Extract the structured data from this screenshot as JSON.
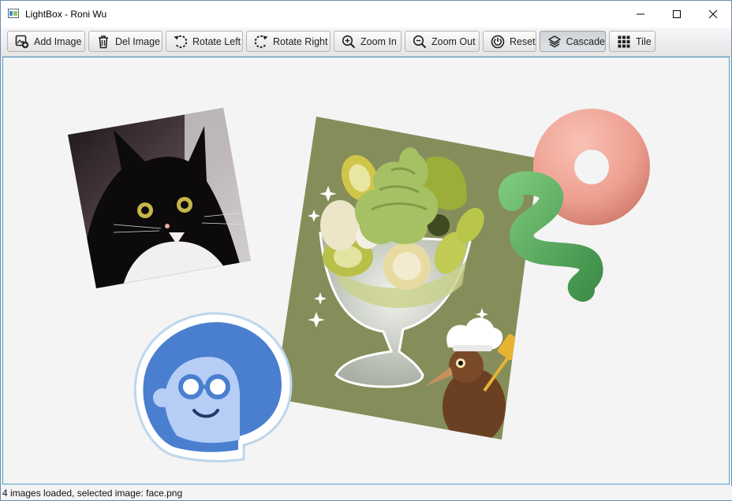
{
  "window": {
    "title": "LightBox - Roni Wu"
  },
  "toolbar": {
    "buttons": [
      {
        "label": "Add Image",
        "icon": "add-image-icon"
      },
      {
        "label": "Del Image",
        "icon": "trash-icon"
      },
      {
        "label": "Rotate Left",
        "icon": "rotate-left-icon"
      },
      {
        "label": "Rotate Right",
        "icon": "rotate-right-icon"
      },
      {
        "label": "Zoom In",
        "icon": "zoom-in-icon"
      },
      {
        "label": "Zoom Out",
        "icon": "zoom-out-icon"
      },
      {
        "label": "Reset",
        "icon": "power-icon"
      },
      {
        "label": "Cascade",
        "icon": "layers-icon",
        "pressed": true
      },
      {
        "label": "Tile",
        "icon": "grid-icon"
      }
    ]
  },
  "canvas": {
    "images": [
      {
        "name": "cat",
        "content": "black-and-white cat photo"
      },
      {
        "name": "parfait",
        "content": "kiwi parfait with chef kiwi bird illustration"
      },
      {
        "name": "donut-squiggle",
        "content": "pink 3D donut and green squiggle"
      },
      {
        "name": "face",
        "content": "blue face sticker",
        "selected": true
      }
    ]
  },
  "status": {
    "text": "4 images loaded, selected image: face.png"
  },
  "colors": {
    "canvas_border": "#4aa3d1",
    "window_border": "#6e8db3",
    "sticker_blue": "#4a7fd0"
  }
}
